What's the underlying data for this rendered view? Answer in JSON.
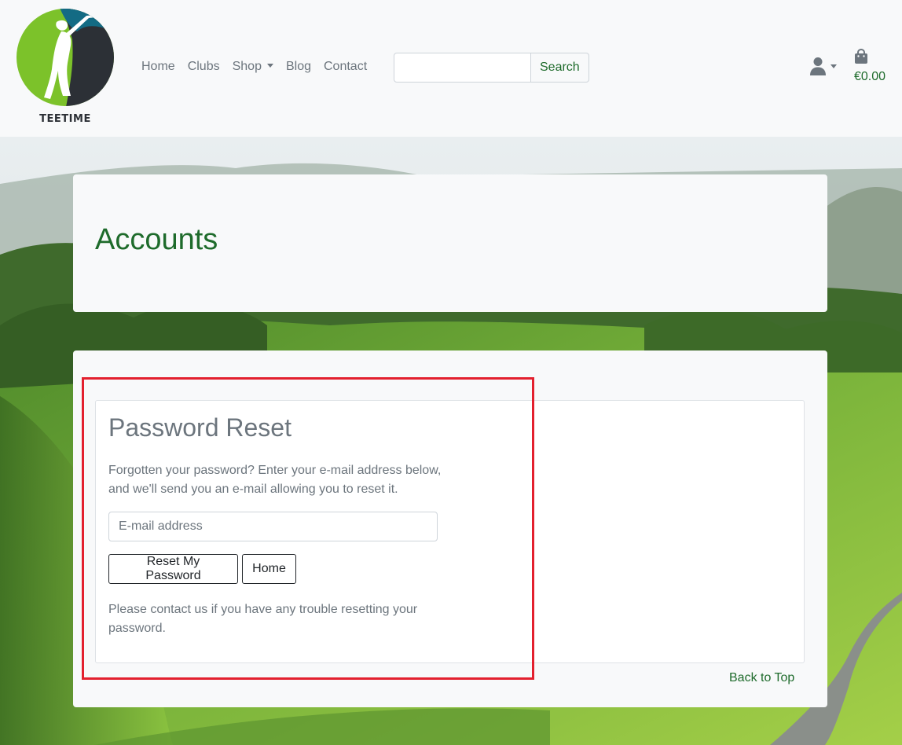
{
  "brand": {
    "logo_text": "TEETIME"
  },
  "nav": {
    "links": [
      "Home",
      "Clubs",
      "Shop",
      "Blog",
      "Contact"
    ]
  },
  "search": {
    "button_label": "Search",
    "placeholder": ""
  },
  "cart": {
    "total": "€0.00"
  },
  "page": {
    "title": "Accounts"
  },
  "password_reset": {
    "heading": "Password Reset",
    "description": "Forgotten your password? Enter your e-mail address below, and we'll send you an e-mail allowing you to reset it.",
    "email_placeholder": "E-mail address",
    "email_value": "",
    "reset_button": "Reset My Password",
    "home_button": "Home",
    "note": "Please contact us if you have any trouble resetting your password."
  },
  "footer": {
    "back_to_top": "Back to Top"
  },
  "colors": {
    "brand_green": "#1e6b2b",
    "highlight_red": "#e3202e",
    "logo_green": "#7cc22a",
    "logo_teal": "#136b84",
    "logo_dark": "#2c3036"
  },
  "icons": [
    "user-icon",
    "shopping-bag-icon",
    "golfer-logo"
  ]
}
